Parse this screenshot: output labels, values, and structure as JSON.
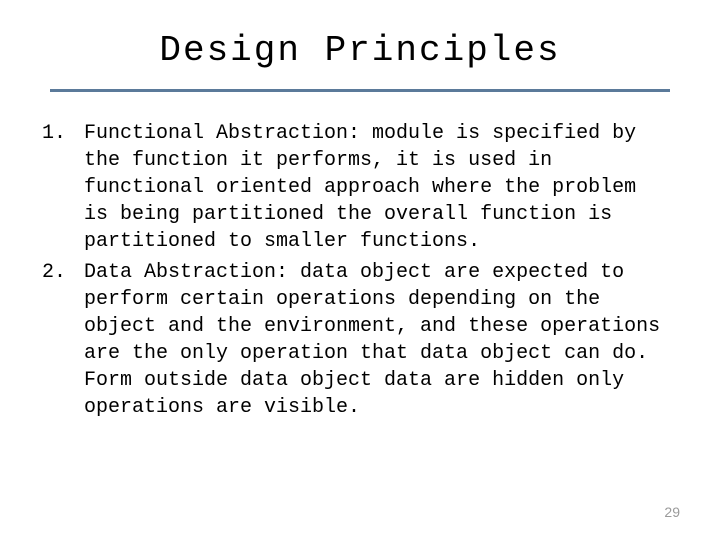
{
  "title": "Design Principles",
  "items": [
    "Functional Abstraction: module is specified by the function it performs, it is used in functional oriented approach where the problem is being partitioned the overall function is partitioned to smaller functions.",
    "Data Abstraction: data object are expected to perform certain operations depending on the object and the environment, and these operations are the only operation that data object can do. Form outside data object data are hidden only operations are visible."
  ],
  "page_number": "29"
}
